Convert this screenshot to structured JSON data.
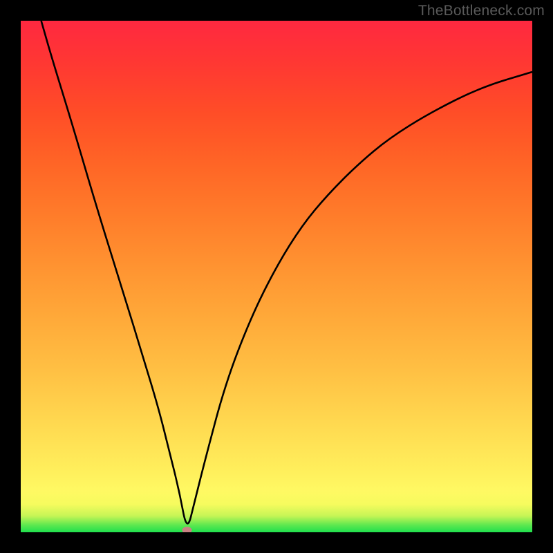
{
  "watermark": "TheBottleneck.com",
  "chart_data": {
    "type": "line",
    "title": "",
    "xlabel": "",
    "ylabel": "",
    "xlim": [
      0,
      100
    ],
    "ylim": [
      0,
      100
    ],
    "grid": false,
    "legend": false,
    "series": [
      {
        "name": "curve",
        "x": [
          4,
          6,
          10,
          15,
          20,
          24,
          27,
          29,
          31,
          32.5,
          34,
          36,
          40,
          45,
          50,
          55,
          60,
          66,
          72,
          80,
          90,
          100
        ],
        "values": [
          100,
          93,
          80,
          63,
          47,
          34,
          24,
          16,
          8,
          0,
          6,
          14,
          29,
          42,
          52,
          60,
          66,
          72,
          77,
          82,
          87,
          90
        ]
      }
    ],
    "annotations": [
      {
        "name": "min-marker",
        "x": 32.5,
        "y": 0
      }
    ],
    "background": {
      "type": "vertical-gradient",
      "stops": [
        {
          "pos": 0,
          "color": "#1fe04e"
        },
        {
          "pos": 8,
          "color": "#fff963"
        },
        {
          "pos": 50,
          "color": "#ffa036"
        },
        {
          "pos": 100,
          "color": "#ff2840"
        }
      ]
    }
  }
}
